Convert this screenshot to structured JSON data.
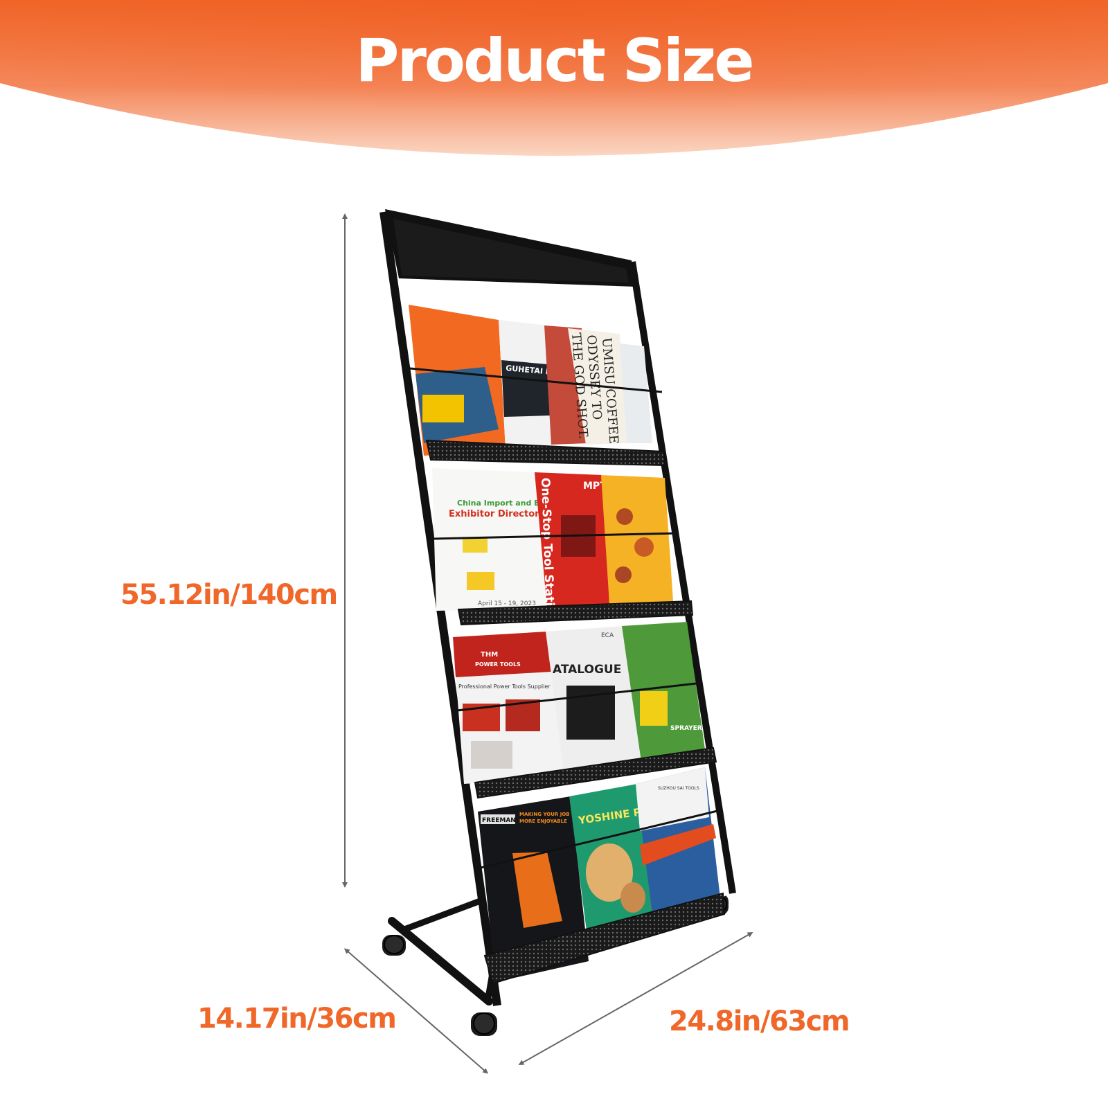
{
  "title": "Product Size",
  "dimensions": {
    "height": "55.12in/140cm",
    "depth": "14.17in/36cm",
    "width": "24.8in/63cm"
  },
  "colors": {
    "banner_orange": "#f0672a",
    "dimension_text": "#f0672a",
    "title_text": "#ffffff",
    "frame": "#111111",
    "dimension_line": "#666666"
  },
  "product": {
    "tiers": 4,
    "casters": 4,
    "brochures": [
      {
        "tier": 1,
        "texts": [
          "GUHETAI MACHI",
          "UMISU COFFEE",
          "ODYSSEY TO",
          "THE GOD SHOT."
        ]
      },
      {
        "tier": 2,
        "texts": [
          "China Import and Export Fair",
          "Exhibitor Directory",
          "April 15 - 19, 2023",
          "One-Stop Tool Station",
          "MPT"
        ]
      },
      {
        "tier": 3,
        "texts": [
          "THM",
          "POWER TOOLS",
          "Professional Power Tools Supplier",
          "ATALOGUE",
          "SPRAYER",
          "ECA"
        ]
      },
      {
        "tier": 4,
        "texts": [
          "FREEMAN",
          "MAKING YOUR JOB",
          "MORE ENJOYABLE",
          "YOSHINE PE",
          "SUZHOU SAI TOOLS"
        ]
      }
    ]
  }
}
